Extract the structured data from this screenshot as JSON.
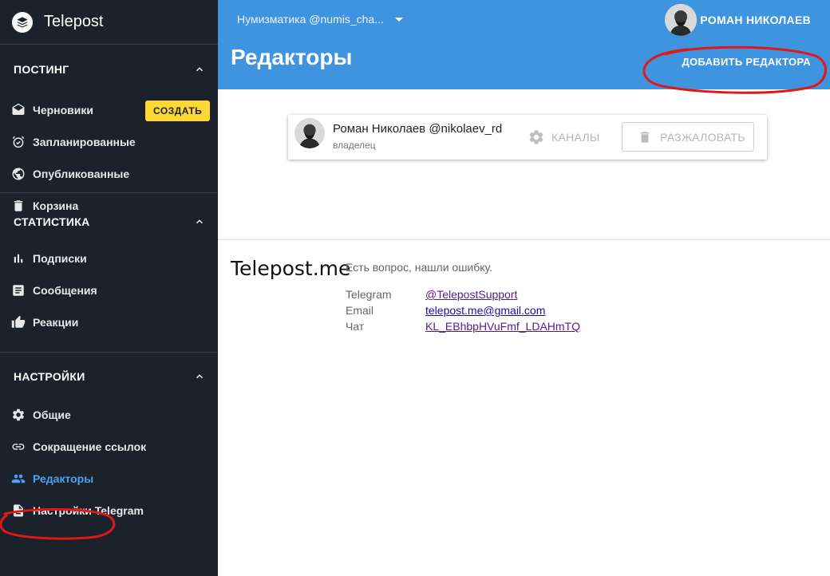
{
  "brand": {
    "name": "Telepost"
  },
  "sidebar": {
    "sections": [
      {
        "title": "ПОСТИНГ",
        "items": [
          {
            "label": "Черновики",
            "icon": "envelope-icon"
          },
          {
            "label": "Запланированные",
            "icon": "alarm-clock-icon"
          },
          {
            "label": "Опубликованные",
            "icon": "globe-icon"
          },
          {
            "label": "Корзина",
            "icon": "trash-icon"
          }
        ],
        "create_label": "СОЗДАТЬ"
      },
      {
        "title": "СТАТИСТИКА",
        "items": [
          {
            "label": "Подписки",
            "icon": "bar-chart-icon"
          },
          {
            "label": "Сообщения",
            "icon": "message-list-icon"
          },
          {
            "label": "Реакции",
            "icon": "thumb-up-icon"
          }
        ]
      },
      {
        "title": "НАСТРОЙКИ",
        "items": [
          {
            "label": "Общие",
            "icon": "gear-icon"
          },
          {
            "label": "Сокращение ссылок",
            "icon": "link-icon"
          },
          {
            "label": "Редакторы",
            "icon": "people-icon",
            "active": true
          },
          {
            "label": "Настройки Telegram",
            "icon": "document-icon"
          }
        ]
      }
    ]
  },
  "header": {
    "channel": "Нумизматика @numis_cha...",
    "user_name": "РОМАН НИКОЛАЕВ",
    "title": "Редакторы",
    "add_editor_label": "ДОБАВИТЬ РЕДАКТОРА"
  },
  "editor": {
    "name": "Роман Николаев @nikolaev_rd",
    "role": "владелец",
    "channels_label": "КАНАЛЫ",
    "demote_label": "РАЗЖАЛОВАТЬ"
  },
  "footer": {
    "logo": "Telepost.me",
    "note": "Есть вопрос, нашли ошибку.",
    "contacts": [
      {
        "key": "Telegram",
        "value": "@TelepostSupport"
      },
      {
        "key": "Email",
        "value": "telepost.me@gmail.com"
      },
      {
        "key": "Чат",
        "value": "KL_EBhbpHVuFmf_LDAHmTQ"
      }
    ]
  },
  "colors": {
    "sidebar_bg": "#1c222b",
    "header_bg": "#3f94e0",
    "accent_active": "#4aa3f0",
    "create_button": "#fdd835",
    "annotation": "#e01818"
  }
}
